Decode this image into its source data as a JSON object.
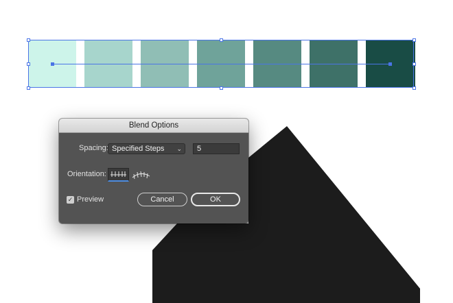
{
  "canvas": {
    "swatch_colors": [
      "#cdf4ea",
      "#a7d5cc",
      "#90beb5",
      "#6fa39a",
      "#568a81",
      "#3e7168",
      "#194c45"
    ],
    "dark_shape_color": "#1c1c1c",
    "selection_color": "#4a74e6"
  },
  "dialog": {
    "title": "Blend Options",
    "spacing_label": "Spacing:",
    "spacing_value": "Specified Steps",
    "steps_value": "5",
    "orientation_label": "Orientation:",
    "preview_label": "Preview",
    "preview_checked": true,
    "cancel_label": "Cancel",
    "ok_label": "OK"
  },
  "icons": {
    "dropdown": "chevron-down-icon",
    "align_page": "align-to-page-icon",
    "align_path": "align-to-path-icon",
    "check": "checkmark-icon"
  }
}
